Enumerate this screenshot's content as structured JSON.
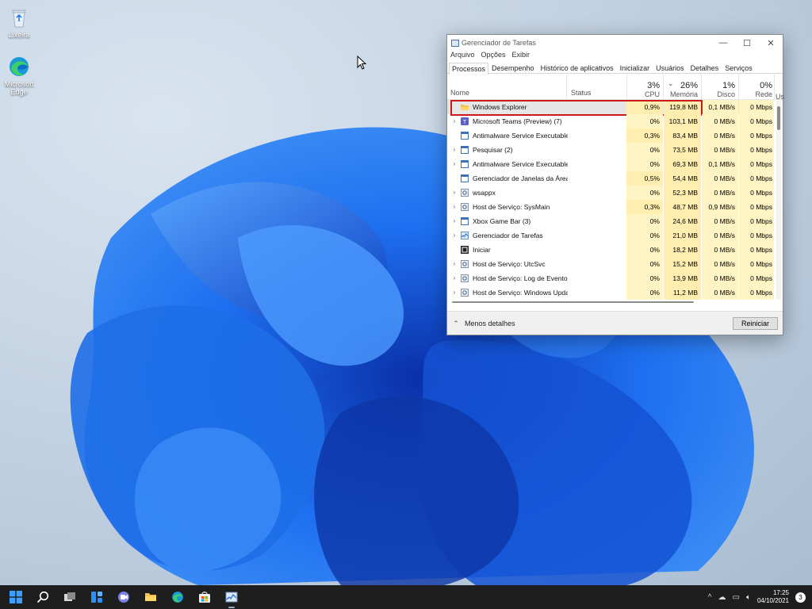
{
  "desktop": {
    "icons": [
      {
        "label": "Lixeira",
        "icon": "recycle-bin-icon"
      },
      {
        "label": "Microsoft Edge",
        "icon": "edge-icon"
      }
    ]
  },
  "window": {
    "title": "Gerenciador de Tarefas",
    "controls": {
      "minimize": "—",
      "maximize": "☐",
      "close": "✕"
    },
    "menu": [
      "Arquivo",
      "Opções",
      "Exibir"
    ],
    "tabs": [
      "Processos",
      "Desempenho",
      "Histórico de aplicativos",
      "Inicializar",
      "Usuários",
      "Detalhes",
      "Serviços"
    ],
    "active_tab": "Processos",
    "columns": {
      "name": "Nome",
      "status": "Status",
      "cpu": {
        "pct": "3%",
        "label": "CPU"
      },
      "memory": {
        "pct": "26%",
        "label": "Memória",
        "sort": "⌄"
      },
      "disk": {
        "pct": "1%",
        "label": "Disco"
      },
      "network": {
        "pct": "0%",
        "label": "Rede"
      },
      "extra": "Us"
    },
    "processes": [
      {
        "name": "Windows Explorer",
        "cpu": "0,9%",
        "memory": "119,8 MB",
        "disk": "0,1 MB/s",
        "network": "0 Mbps",
        "expand": "",
        "icon": "folder-icon",
        "selected": true
      },
      {
        "name": "Microsoft Teams (Preview) (7)",
        "cpu": "0%",
        "memory": "103,1 MB",
        "disk": "0 MB/s",
        "network": "0 Mbps",
        "expand": "›",
        "icon": "teams-icon"
      },
      {
        "name": "Antimalware Service Executable...",
        "cpu": "0,3%",
        "memory": "83,4 MB",
        "disk": "0 MB/s",
        "network": "0 Mbps",
        "expand": "",
        "icon": "app-window-icon"
      },
      {
        "name": "Pesquisar (2)",
        "cpu": "0%",
        "memory": "73,5 MB",
        "disk": "0 MB/s",
        "network": "0 Mbps",
        "expand": "›",
        "icon": "app-window-icon"
      },
      {
        "name": "Antimalware Service Executable",
        "cpu": "0%",
        "memory": "69,3 MB",
        "disk": "0,1 MB/s",
        "network": "0 Mbps",
        "expand": "›",
        "icon": "app-window-icon"
      },
      {
        "name": "Gerenciador de Janelas da Área ...",
        "cpu": "0,5%",
        "memory": "54,4 MB",
        "disk": "0 MB/s",
        "network": "0 Mbps",
        "expand": "",
        "icon": "app-window-icon"
      },
      {
        "name": "wsappx",
        "cpu": "0%",
        "memory": "52,3 MB",
        "disk": "0 MB/s",
        "network": "0 Mbps",
        "expand": "›",
        "icon": "service-gear-icon"
      },
      {
        "name": "Host de Serviço: SysMain",
        "cpu": "0,3%",
        "memory": "48,7 MB",
        "disk": "0,9 MB/s",
        "network": "0 Mbps",
        "expand": "›",
        "icon": "service-gear-icon"
      },
      {
        "name": "Xbox Game Bar (3)",
        "cpu": "0%",
        "memory": "24,6 MB",
        "disk": "0 MB/s",
        "network": "0 Mbps",
        "expand": "›",
        "icon": "app-window-icon"
      },
      {
        "name": "Gerenciador de Tarefas",
        "cpu": "0%",
        "memory": "21,0 MB",
        "disk": "0 MB/s",
        "network": "0 Mbps",
        "expand": "›",
        "icon": "task-manager-icon"
      },
      {
        "name": "Iniciar",
        "cpu": "0%",
        "memory": "18,2 MB",
        "disk": "0 MB/s",
        "network": "0 Mbps",
        "expand": "",
        "icon": "start-app-icon"
      },
      {
        "name": "Host de Serviço: UtcSvc",
        "cpu": "0%",
        "memory": "15,2 MB",
        "disk": "0 MB/s",
        "network": "0 Mbps",
        "expand": "›",
        "icon": "service-gear-icon"
      },
      {
        "name": "Host de Serviço: Log de Eventos...",
        "cpu": "0%",
        "memory": "13,9 MB",
        "disk": "0 MB/s",
        "network": "0 Mbps",
        "expand": "›",
        "icon": "service-gear-icon"
      },
      {
        "name": "Host de Serviço: Windows Update",
        "cpu": "0%",
        "memory": "11,2 MB",
        "disk": "0 MB/s",
        "network": "0 Mbps",
        "expand": "›",
        "icon": "service-gear-icon"
      }
    ],
    "footer": {
      "less_details": "Menos detalhes",
      "restart": "Reiniciar"
    }
  },
  "taskbar": {
    "icons": [
      "start-icon",
      "search-icon",
      "task-view-icon",
      "widgets-icon",
      "chat-icon",
      "file-explorer-icon",
      "edge-icon",
      "store-icon",
      "task-manager-icon"
    ],
    "tray": {
      "chevron": "^",
      "time": "17:25",
      "date": "04/10/2021",
      "notifications": "3"
    }
  },
  "colors": {
    "highlight_border": "#cc1a1a",
    "taskbar": "#1e1e1e",
    "accent": "#0a5bd6"
  }
}
